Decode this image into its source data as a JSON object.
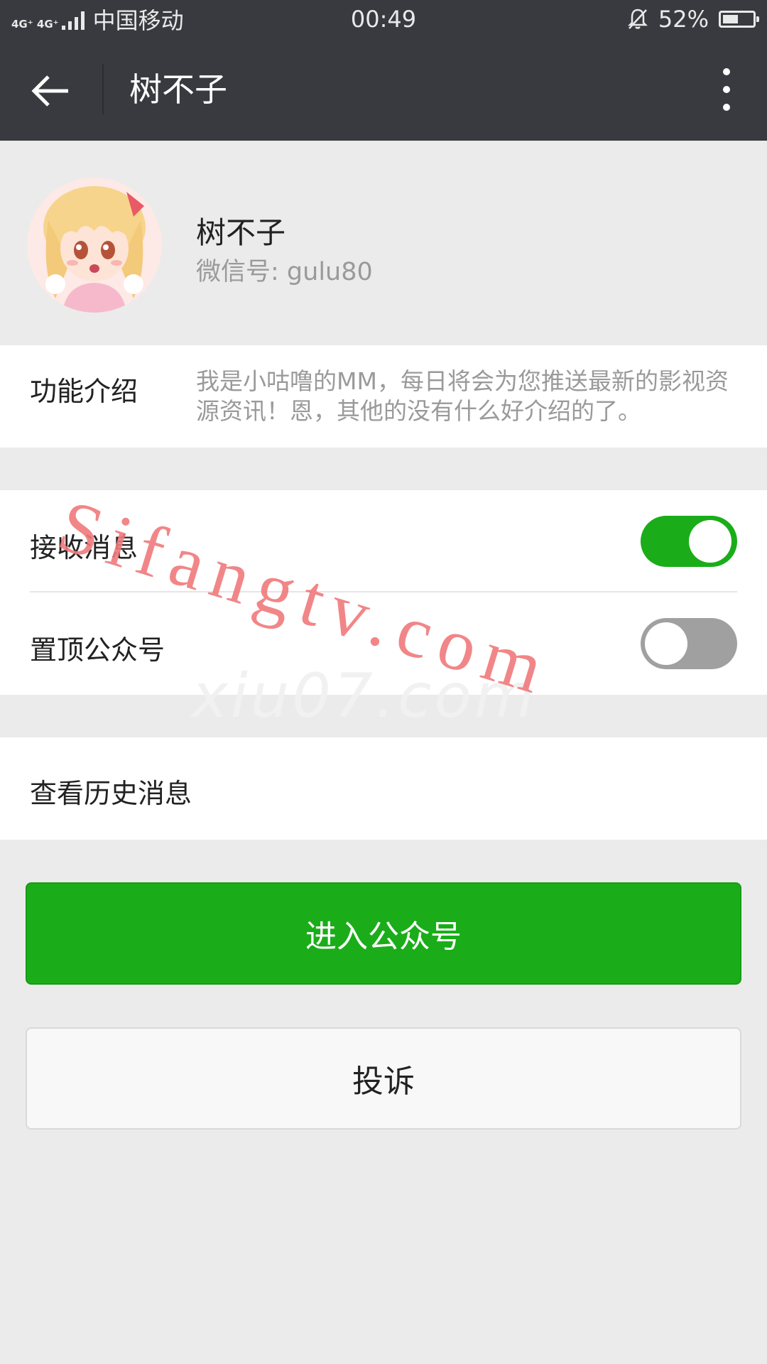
{
  "status_bar": {
    "network": "4G⁺ 4G⁺",
    "carrier": "中国移动",
    "time": "00:49",
    "battery": "52%",
    "battery_level": 0.52
  },
  "header": {
    "title": "树不子"
  },
  "profile": {
    "name": "树不子",
    "wechat_id": "微信号: gulu80"
  },
  "intro": {
    "label": "功能介绍",
    "text": "我是小咕噜的MM，每日将会为您推送最新的影视资源资讯！恩，其他的没有什么好介绍的了。"
  },
  "settings": {
    "receive_messages": {
      "label": "接收消息",
      "enabled": true
    },
    "pin_account": {
      "label": "置顶公众号",
      "enabled": false
    }
  },
  "history": {
    "label": "查看历史消息"
  },
  "buttons": {
    "enter": "进入公众号",
    "report": "投诉"
  },
  "watermark": {
    "text": "Sifangtv.com",
    "faint_text": "xiu07.com"
  },
  "colors": {
    "titlebar": "#393a3f",
    "accent_green": "#1aad19",
    "background": "#ebebeb"
  }
}
